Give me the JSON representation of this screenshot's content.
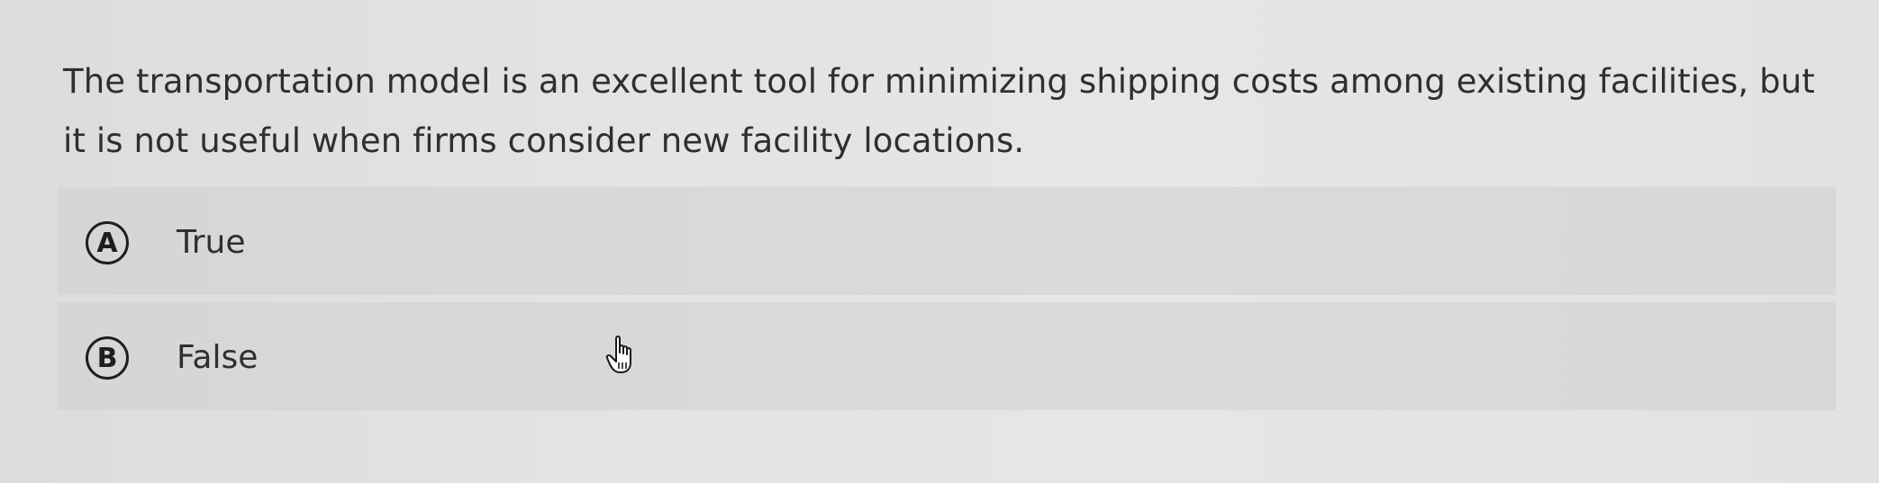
{
  "question": {
    "text": "The transportation model is an excellent tool for minimizing shipping costs among existing facilities, but it is not useful when firms consider new facility locations."
  },
  "options": [
    {
      "letter": "A",
      "label": "True"
    },
    {
      "letter": "B",
      "label": "False"
    }
  ],
  "cursor": {
    "icon": "hand-pointer-icon"
  },
  "colors": {
    "background": "#e3e3e1",
    "option_background": "#d6d6d4",
    "text": "#2f2f2f"
  }
}
